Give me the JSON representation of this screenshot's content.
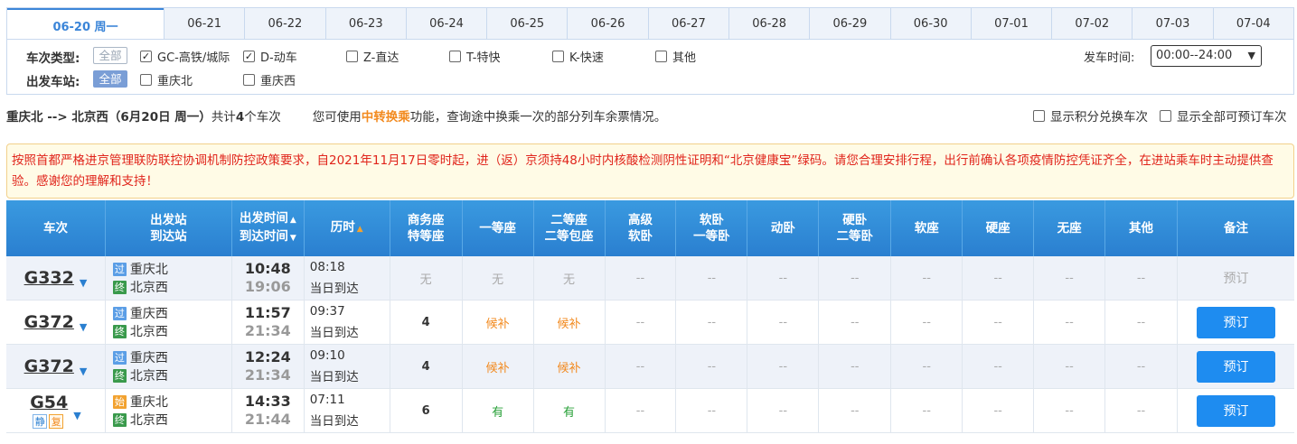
{
  "dates": [
    "06-20 周一",
    "06-21",
    "06-22",
    "06-23",
    "06-24",
    "06-25",
    "06-26",
    "06-27",
    "06-28",
    "06-29",
    "06-30",
    "07-01",
    "07-02",
    "07-03",
    "07-04"
  ],
  "filter": {
    "type_label": "车次类型:",
    "station_label": "出发车站:",
    "all_label": "全部",
    "types": [
      {
        "label": "GC-高铁/城际",
        "checked": true
      },
      {
        "label": "D-动车",
        "checked": true
      },
      {
        "label": "Z-直达",
        "checked": false
      },
      {
        "label": "T-特快",
        "checked": false
      },
      {
        "label": "K-快速",
        "checked": false
      },
      {
        "label": "其他",
        "checked": false
      }
    ],
    "stations": [
      {
        "label": "重庆北",
        "checked": false
      },
      {
        "label": "重庆西",
        "checked": false
      }
    ],
    "time_label": "发车时间:",
    "time_value": "00:00--24:00"
  },
  "summary": {
    "route": "重庆北 --> 北京西（6月20日 周一）",
    "count_prefix": "共计",
    "count": "4",
    "count_suffix": "个车次",
    "tip_prefix": "您可使用",
    "tip_link": "中转换乘",
    "tip_suffix": "功能，查询途中换乘一次的部分列车余票情况。",
    "opt1": "显示积分兑换车次",
    "opt2": "显示全部可预订车次"
  },
  "notice": "按照首都严格进京管理联防联控协调机制防控政策要求，自2021年11月17日零时起，进（返）京须持48小时内核酸检测阴性证明和“北京健康宝”绿码。请您合理安排行程，出行前确认各项疫情防控凭证齐全，在进站乘车时主动提供查验。感谢您的理解和支持！",
  "headers": {
    "train": "车次",
    "stations": [
      "出发站",
      "到达站"
    ],
    "times": [
      "出发时间",
      "到达时间"
    ],
    "duration": "历时",
    "business": [
      "商务座",
      "特等座"
    ],
    "first": "一等座",
    "second": [
      "二等座",
      "二等包座"
    ],
    "deluxe_sleeper": [
      "高级",
      "软卧"
    ],
    "soft_sleeper": [
      "软卧",
      "一等卧"
    ],
    "moving_sleeper": "动卧",
    "hard_sleeper": [
      "硬卧",
      "二等卧"
    ],
    "soft_seat": "软座",
    "hard_seat": "硬座",
    "no_seat": "无座",
    "other": "其他",
    "remark": "备注"
  },
  "trains": [
    {
      "no": "G332",
      "tags": [],
      "from_tag": "过",
      "from": "重庆北",
      "to_tag": "终",
      "to": "北京西",
      "dep": "10:48",
      "arr": "19:06",
      "dur": "08:18",
      "dur_note": "当日到达",
      "seats": [
        "无",
        "无",
        "无",
        "--",
        "--",
        "--",
        "--",
        "--",
        "--",
        "--",
        "--"
      ],
      "action": "预订",
      "action_enabled": false
    },
    {
      "no": "G372",
      "tags": [],
      "from_tag": "过",
      "from": "重庆西",
      "to_tag": "终",
      "to": "北京西",
      "dep": "11:57",
      "arr": "21:34",
      "dur": "09:37",
      "dur_note": "当日到达",
      "seats": [
        "4",
        "候补",
        "候补",
        "--",
        "--",
        "--",
        "--",
        "--",
        "--",
        "--",
        "--"
      ],
      "action": "预订",
      "action_enabled": true
    },
    {
      "no": "G372",
      "tags": [],
      "from_tag": "过",
      "from": "重庆西",
      "to_tag": "终",
      "to": "北京西",
      "dep": "12:24",
      "arr": "21:34",
      "dur": "09:10",
      "dur_note": "当日到达",
      "seats": [
        "4",
        "候补",
        "候补",
        "--",
        "--",
        "--",
        "--",
        "--",
        "--",
        "--",
        "--"
      ],
      "action": "预订",
      "action_enabled": true
    },
    {
      "no": "G54",
      "tags": [
        "静",
        "复"
      ],
      "from_tag": "始",
      "from": "重庆北",
      "to_tag": "终",
      "to": "北京西",
      "dep": "14:33",
      "arr": "21:44",
      "dur": "07:11",
      "dur_note": "当日到达",
      "seats": [
        "6",
        "有",
        "有",
        "--",
        "--",
        "--",
        "--",
        "--",
        "--",
        "--",
        "--"
      ],
      "action": "预订",
      "action_enabled": true
    }
  ]
}
